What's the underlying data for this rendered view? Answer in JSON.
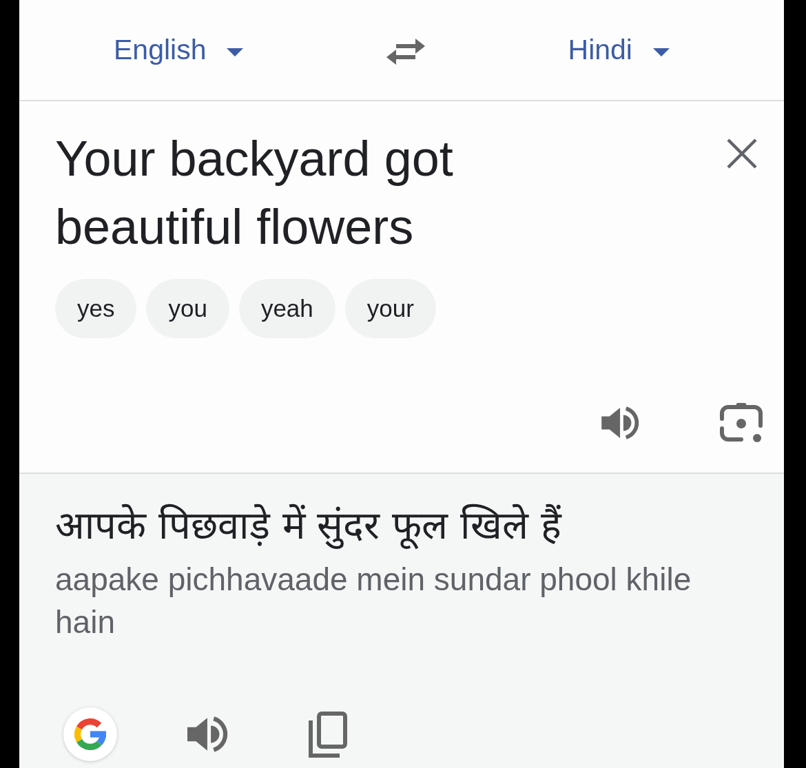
{
  "language_bar": {
    "source_language": "English",
    "target_language": "Hindi"
  },
  "input": {
    "text": "Your backyard got beautiful flowers",
    "suggestions": [
      "yes",
      "you",
      "yeah",
      "your"
    ]
  },
  "output": {
    "translation": "आपके पिछवाड़े में सुंदर फूल खिले हैं",
    "transliteration": "aapake pichhavaade mein sundar phool khile hain"
  }
}
